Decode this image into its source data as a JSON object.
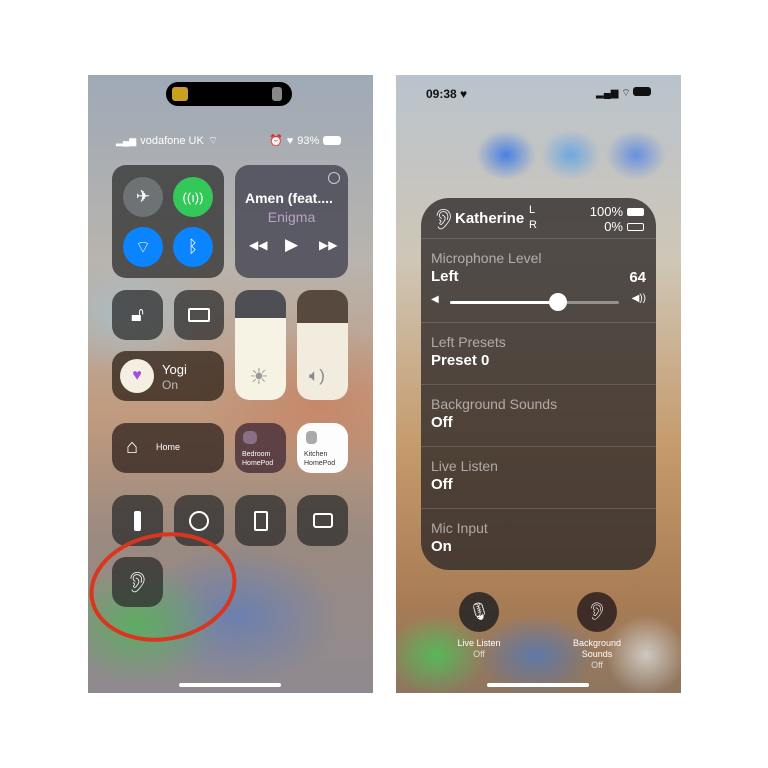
{
  "left": {
    "status": {
      "carrier": "vodafone UK",
      "battery": "93%"
    },
    "music": {
      "title": "Amen (feat....",
      "artist": "Enigma"
    },
    "focus": {
      "name": "Yogi",
      "state": "On"
    },
    "home": {
      "label": "Home"
    },
    "homepods": [
      {
        "label": "Bedroom HomePod"
      },
      {
        "label": "Kitchen HomePod"
      }
    ],
    "brightness_level": 0.75,
    "volume_level": 0.7,
    "colors": {
      "cellular": "#34c759",
      "wifi": "#0a84ff",
      "bluetooth": "#0a84ff",
      "focus_heart": "#a24ee0",
      "annotation": "#d8361f"
    }
  },
  "right": {
    "status": {
      "time": "09:38"
    },
    "device": {
      "name": "Katherine",
      "left_label": "L",
      "right_label": "R",
      "left_battery": "100%",
      "right_battery": "0%"
    },
    "mic_level": {
      "label": "Microphone Level",
      "side": "Left",
      "value": "64",
      "fraction": 0.64
    },
    "sections": [
      {
        "label": "Left Presets",
        "value": "Preset 0"
      },
      {
        "label": "Background Sounds",
        "value": "Off"
      },
      {
        "label": "Live Listen",
        "value": "Off"
      },
      {
        "label": "Mic Input",
        "value": "On"
      }
    ],
    "buttons": [
      {
        "label": "Live Listen",
        "state": "Off"
      },
      {
        "label": "Background Sounds",
        "state": "Off"
      }
    ]
  }
}
